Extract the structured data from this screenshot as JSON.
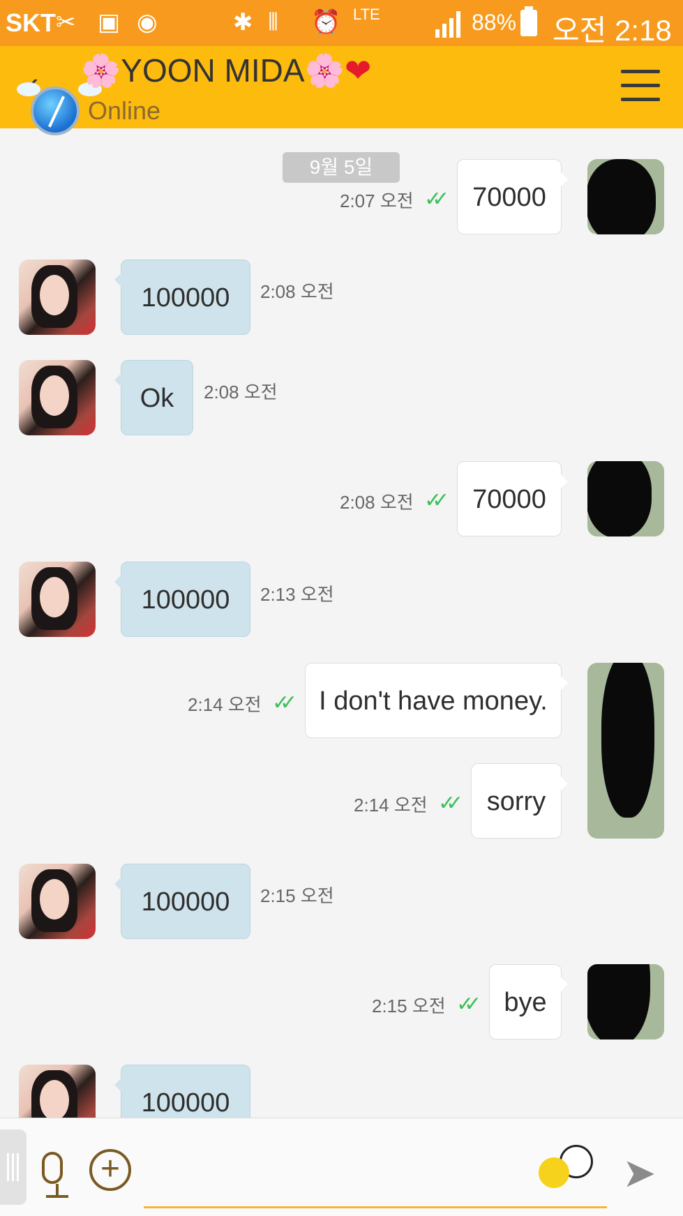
{
  "status_bar": {
    "carrier": "SKT",
    "battery": "88%",
    "time": "오전 2:18",
    "network": "LTE"
  },
  "header": {
    "title_deco_left": "🌸",
    "title": "YOON MIDA",
    "title_deco_right": "🌸",
    "heart": "❤",
    "status": "Online",
    "back_icon": "‹",
    "menu_icon": "menu-icon"
  },
  "chat": {
    "date_divider": "9월 5일",
    "messages": [
      {
        "dir": "out",
        "text": "70000",
        "time": "2:07 오전",
        "read": "✓✓"
      },
      {
        "dir": "in",
        "text": "100000",
        "time": "2:08 오전"
      },
      {
        "dir": "in",
        "text": "Ok",
        "time": "2:08 오전"
      },
      {
        "dir": "out",
        "text": "70000",
        "time": "2:08 오전",
        "read": "✓✓"
      },
      {
        "dir": "in",
        "text": "100000",
        "time": "2:13 오전"
      },
      {
        "dir": "out",
        "text": "I don't have money.",
        "time": "2:14 오전",
        "read": "✓✓"
      },
      {
        "dir": "out",
        "text": "sorry",
        "time": "2:14 오전",
        "read": "✓✓"
      },
      {
        "dir": "in",
        "text": "100000",
        "time": "2:15 오전"
      },
      {
        "dir": "out",
        "text": "bye",
        "time": "2:15 오전",
        "read": "✓✓"
      },
      {
        "dir": "in",
        "text": "100000",
        "time": ""
      }
    ]
  },
  "input": {
    "placeholder": "",
    "plus": "+",
    "send": "➤"
  },
  "colors": {
    "status_bar": "#f79a1e",
    "header": "#fdbb0e",
    "incoming_bubble": "#cfe3ec",
    "outgoing_bubble": "#ffffff",
    "read_check": "#3cc05a"
  }
}
